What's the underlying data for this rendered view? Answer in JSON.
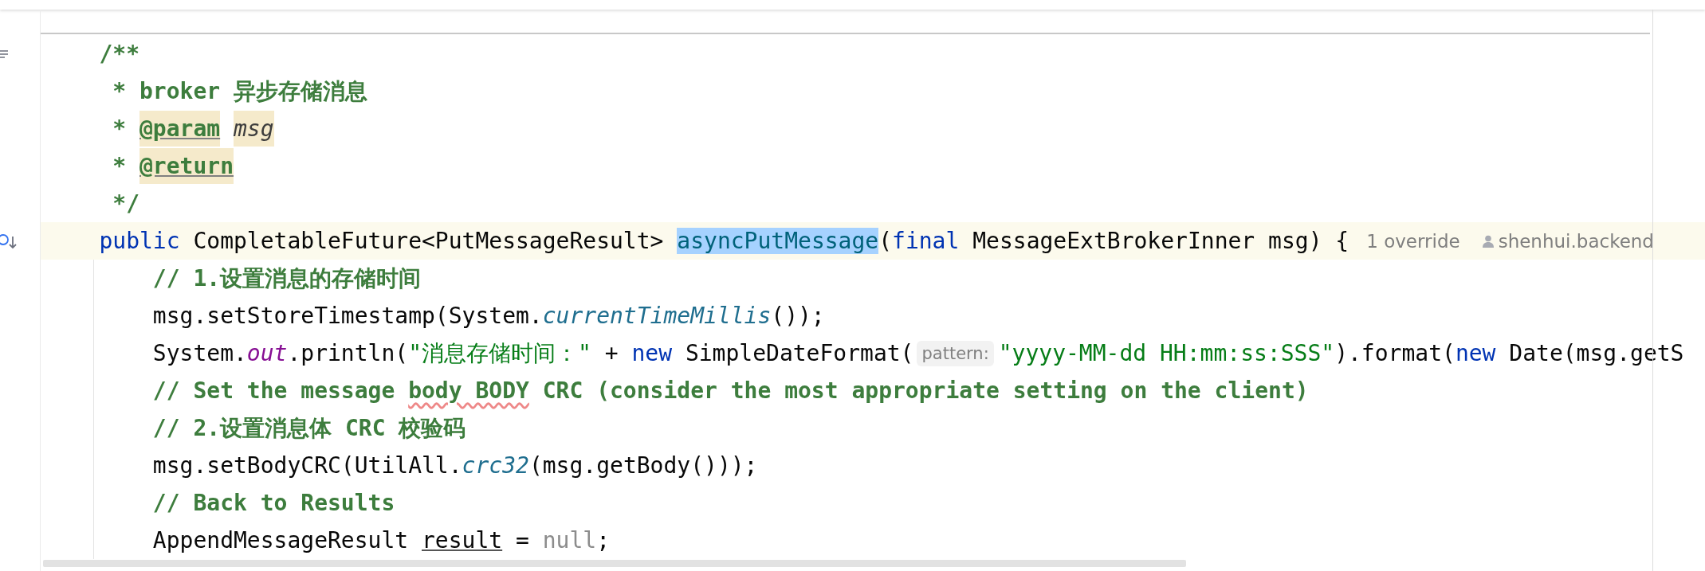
{
  "editor": {
    "lines": [
      {
        "current": false,
        "gutter_icon": {
          "kind": "lines"
        },
        "segments": [
          {
            "kind": "code",
            "tokens": [
              {
                "text": "/**",
                "kind": "comment"
              }
            ]
          }
        ]
      },
      {
        "current": false,
        "segments": [
          {
            "kind": "code",
            "tokens": [
              {
                "text": " * broker 异步存储消息",
                "kind": "comment"
              }
            ]
          }
        ]
      },
      {
        "current": false,
        "segments": [
          {
            "kind": "code",
            "tokens": [
              {
                "text": " * ",
                "kind": "comment"
              },
              {
                "text": "@param",
                "kind": "doc-tag"
              },
              {
                "text": "msg",
                "kind": "doc-param",
                "space_before": true
              }
            ]
          }
        ]
      },
      {
        "current": false,
        "segments": [
          {
            "kind": "code",
            "tokens": [
              {
                "text": " * ",
                "kind": "comment"
              },
              {
                "text": "@return",
                "kind": "doc-tag"
              }
            ]
          }
        ]
      },
      {
        "current": false,
        "segments": [
          {
            "kind": "code",
            "tokens": [
              {
                "text": " */",
                "kind": "comment"
              }
            ]
          }
        ]
      },
      {
        "current": true,
        "gutter_icon": {
          "kind": "override"
        },
        "segments": [
          {
            "kind": "code",
            "tokens": [
              {
                "text": "public",
                "kind": "keyword"
              },
              {
                "text": " CompletableFuture<PutMessageResult> ",
                "kind": "plain"
              },
              {
                "text": "asyncPutMessage",
                "kind": "selected"
              },
              {
                "text": "(",
                "kind": "plain"
              },
              {
                "text": "final",
                "kind": "keyword"
              },
              {
                "text": " MessageExtBrokerInner msg) {",
                "kind": "plain"
              }
            ]
          },
          {
            "kind": "inlay",
            "text": "1 override"
          },
          {
            "kind": "author",
            "text": "shenhui.backend"
          }
        ],
        "children": [
          {
            "current": false,
            "segments": [
              {
                "kind": "code",
                "tokens": [
                  {
                    "text": "// 1.设置消息的存储时间",
                    "kind": "comment"
                  }
                ]
              }
            ]
          },
          {
            "current": false,
            "segments": [
              {
                "kind": "code",
                "tokens": [
                  {
                    "text": "msg.setStoreTimestamp(System.",
                    "kind": "plain"
                  },
                  {
                    "text": "currentTimeMillis",
                    "kind": "static"
                  },
                  {
                    "text": "());",
                    "kind": "plain"
                  }
                ]
              }
            ]
          },
          {
            "current": false,
            "segments": [
              {
                "kind": "code",
                "tokens": [
                  {
                    "text": "System.",
                    "kind": "plain"
                  },
                  {
                    "text": "out",
                    "kind": "field"
                  },
                  {
                    "text": ".println(",
                    "kind": "plain"
                  },
                  {
                    "text": "\"消息存储时间：\"",
                    "kind": "string"
                  },
                  {
                    "text": " + ",
                    "kind": "plain"
                  },
                  {
                    "text": "new",
                    "kind": "keyword"
                  },
                  {
                    "text": " SimpleDateFormat(",
                    "kind": "plain"
                  }
                ]
              },
              {
                "kind": "hint",
                "text": "pattern:"
              },
              {
                "kind": "code",
                "tokens": [
                  {
                    "text": "\"yyyy-MM-dd HH:mm:ss:SSS\"",
                    "kind": "string"
                  },
                  {
                    "text": ").format(",
                    "kind": "plain"
                  },
                  {
                    "text": "new",
                    "kind": "keyword"
                  },
                  {
                    "text": " Date(msg.getS",
                    "kind": "plain"
                  }
                ]
              }
            ]
          },
          {
            "current": false,
            "segments": [
              {
                "kind": "code",
                "tokens": [
                  {
                    "text": "// Set the message ",
                    "kind": "comment"
                  },
                  {
                    "text": "body BODY",
                    "kind": "typo"
                  },
                  {
                    "text": " CRC (consider the most appropriate setting on the client)",
                    "kind": "comment"
                  }
                ]
              }
            ]
          },
          {
            "current": false,
            "segments": [
              {
                "kind": "code",
                "tokens": [
                  {
                    "text": "// 2.设置消息体 CRC 校验码",
                    "kind": "comment"
                  }
                ]
              }
            ]
          },
          {
            "current": false,
            "segments": [
              {
                "kind": "code",
                "tokens": [
                  {
                    "text": "msg.setBodyCRC(UtilAll.",
                    "kind": "plain"
                  },
                  {
                    "text": "crc32",
                    "kind": "static"
                  },
                  {
                    "text": "(msg.getBody()));",
                    "kind": "plain"
                  }
                ]
              }
            ]
          },
          {
            "current": false,
            "segments": [
              {
                "kind": "code",
                "tokens": [
                  {
                    "text": "// Back to Results",
                    "kind": "comment"
                  }
                ]
              }
            ]
          },
          {
            "current": false,
            "segments": [
              {
                "kind": "code",
                "tokens": [
                  {
                    "text": "AppendMessageResult ",
                    "kind": "plain"
                  },
                  {
                    "text": "result",
                    "kind": "underlined"
                  },
                  {
                    "text": " = ",
                    "kind": "plain"
                  },
                  {
                    "text": "null",
                    "kind": "null"
                  },
                  {
                    "text": ";",
                    "kind": "plain"
                  }
                ]
              }
            ]
          }
        ]
      }
    ]
  }
}
